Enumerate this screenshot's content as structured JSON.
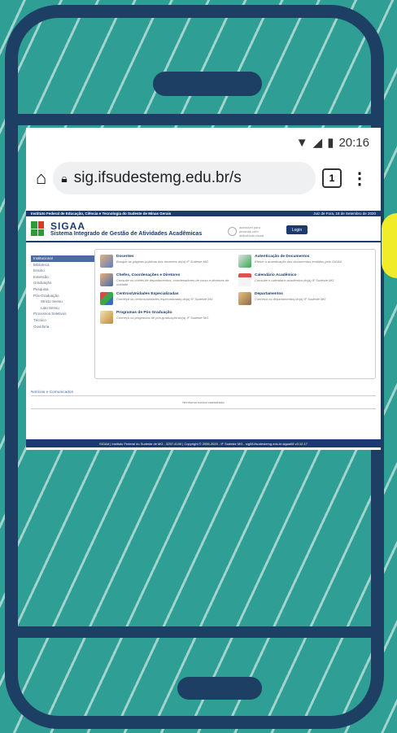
{
  "status": {
    "time": "20:16"
  },
  "browser": {
    "url": "sig.ifsudestemg.edu.br/s",
    "tab_count": "1"
  },
  "site": {
    "institution": "Instituto Federal de Educação, Ciência e Tecnologia do Sudeste de Minas Gerais",
    "date": "Juiz de Fora, 18 de Setembro de 2020",
    "brand_name": "SIGAA",
    "brand_tagline": "Sistema Integrado de Gestão de Atividades Acadêmicas",
    "accessibility_text": "acessível para pessoas com deficiência visual",
    "login_label": "Login",
    "menu": [
      "Institucional",
      "Biblioteca",
      "Ensino",
      "Extensão",
      "Graduação",
      "Pesquisa",
      "Pós-Graduação",
      "Stricto Sensu",
      "Lato Sensu",
      "Processos Seletivos",
      "Técnico",
      "Ouvidoria"
    ],
    "cards": [
      {
        "title": "Docentes",
        "desc": "Busque as páginas públicas dos docentes do(a) IF Sudeste MG"
      },
      {
        "title": "Autenticação de Documentos",
        "desc": "Efetue a autenticação dos documentos emitidos pelo SIGAA"
      },
      {
        "title": "Chefes, Coordenações e Diretores",
        "desc": "Consulte os chefes de departamentos, coordenadores de curso e diretores de unidade"
      },
      {
        "title": "Calendário Acadêmico",
        "desc": "Consulte o calendário acadêmico do(a) IF Sudeste MG"
      },
      {
        "title": "Centros/Unidades Especializadas",
        "desc": "Conheça os centros/unidades especializadas do(a) IF Sudeste MG"
      },
      {
        "title": "Departamentos",
        "desc": "Conheça os departamentos do(a) IF Sudeste MG"
      },
      {
        "title": "Programas de Pós Graduação",
        "desc": "Conheça os programas de pós-graduação do(a) IF Sudeste MG"
      }
    ],
    "news_title": "Notícias e Comunicados",
    "news_empty": "Nenhuma notícia cadastrada",
    "footer": "SIGAA | Instituto Federal do Sudeste de MG - 3257-4100 | Copyright © 2006-2020 - IF Sudeste MG - sig08.ifsudestemg.edu.br.sigaa08 v3.12.17"
  },
  "colors": {
    "teal": "#2f9e94",
    "navy": "#1d3f63",
    "accent_yellow": "#f0ec2a"
  }
}
